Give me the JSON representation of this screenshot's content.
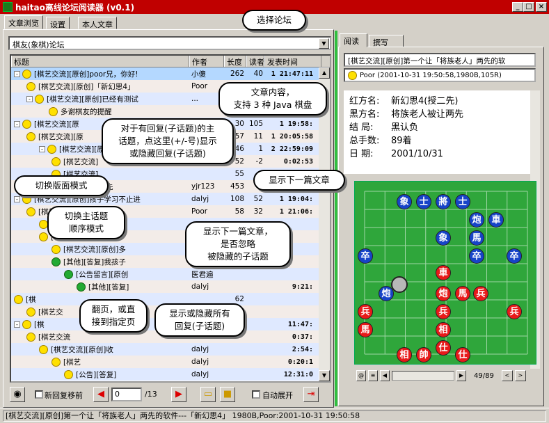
{
  "window": {
    "title": "haitao离线论坛阅读器 (v0.1)",
    "min": "_",
    "max": "□",
    "close": "×"
  },
  "tabs": [
    "文章浏览",
    "设置",
    "本人文章"
  ],
  "forum_select": "棋友(象棋)论坛",
  "columns": {
    "title": "标题",
    "author": "作者",
    "length": "长度",
    "reads": "读者",
    "time": "发表时间"
  },
  "rows": [
    {
      "title": "[棋艺交流][原创]poor兄，你好!",
      "author": "小傻",
      "len": "262",
      "reads": "40",
      "time": "1 21:47:11",
      "pm": "-",
      "sel": true
    },
    {
      "title": "[棋艺交流][原创]「新幻思4」",
      "author": "Poor",
      "len": "",
      "reads": "",
      "time": "",
      "pm": ""
    },
    {
      "title": "[棋艺交流][原创]已经有测试",
      "author": "...",
      "len": "",
      "reads": "",
      "time": "",
      "pm": "-"
    },
    {
      "title": "多谢棋友的提醒",
      "author": "",
      "len": "",
      "reads": "",
      "time": "",
      "pm": ""
    },
    {
      "title": "[棋艺交流][原",
      "author": "",
      "len": "30",
      "reads": "105",
      "time": "1 19:58:",
      "pm": "-"
    },
    {
      "title": "[棋艺交流][原",
      "author": "",
      "len": "57",
      "reads": "11",
      "time": "1 20:05:58",
      "pm": ""
    },
    {
      "title": "[棋艺交流][原",
      "author": "",
      "len": "46",
      "reads": "1",
      "time": "2 22:59:09",
      "pm": "-"
    },
    {
      "title": "[棋艺交流]",
      "author": "",
      "len": "52",
      "reads": "-2",
      "time": "0:02:53",
      "pm": ""
    },
    {
      "title": "[棋艺交流]",
      "author": "",
      "len": "55",
      "reads": "",
      "time": "1 18:00:08",
      "pm": ""
    },
    {
      "title": "[棋艺交流][原创]让X先",
      "author": "yjr123",
      "len": "453",
      "reads": "",
      "time": "",
      "pm": ""
    },
    {
      "title": "[棋艺交流][原创]孩子学习不止进",
      "author": "dalyj",
      "len": "108",
      "reads": "52",
      "time": "1 19:04:",
      "pm": "-"
    },
    {
      "title": "[棋艺交流]大了?是",
      "author": "Poor",
      "len": "58",
      "reads": "32",
      "time": "1 21:06:",
      "pm": ""
    },
    {
      "title": "[棋艺交流]是小学4年",
      "author": "",
      "len": "",
      "reads": "",
      "time": "",
      "pm": ""
    },
    {
      "title": "[棋艺交流][原创]可私",
      "author": "",
      "len": "",
      "reads": "",
      "time": "",
      "pm": ""
    },
    {
      "title": "[棋艺交流][原创]多",
      "author": "",
      "len": "",
      "reads": "",
      "time": "",
      "pm": ""
    },
    {
      "title": "[其他][答复]我孩子",
      "author": "",
      "len": "",
      "reads": "",
      "time": "",
      "pm": ""
    },
    {
      "title": "[公告留言][原创",
      "author": "医君遍",
      "len": "",
      "reads": "",
      "time": "",
      "pm": ""
    },
    {
      "title": "[其他][答复]",
      "author": "dalyj",
      "len": "",
      "reads": "",
      "time": "9:21:",
      "pm": ""
    },
    {
      "title": "[棋",
      "author": "",
      "len": "62",
      "reads": "",
      "time": "",
      "pm": ""
    },
    {
      "title": "[棋艺交",
      "author": "",
      "len": "",
      "reads": "",
      "time": "",
      "pm": ""
    },
    {
      "title": "[棋",
      "author": "",
      "len": "",
      "reads": "",
      "time": "11:47:",
      "pm": "-"
    },
    {
      "title": "[棋艺交流",
      "author": "",
      "len": "",
      "reads": "",
      "time": "0:37:",
      "pm": ""
    },
    {
      "title": "[棋艺交流][原创]收",
      "author": "dalyj",
      "len": "",
      "reads": "",
      "time": "2:54:",
      "pm": ""
    },
    {
      "title": "[棋艺",
      "author": "dalyj",
      "len": "",
      "reads": "",
      "time": "0:20:1",
      "pm": ""
    },
    {
      "title": "[公告][答复]",
      "author": "dalyj",
      "len": "",
      "reads": "",
      "time": "12:31:0",
      "pm": ""
    }
  ],
  "toolbar": {
    "new_reply_label": "新回复移前",
    "page_value": "0",
    "page_total": "/13",
    "auto_expand_label": "自动展开"
  },
  "callouts": {
    "select_forum": "选择论坛",
    "article_content": "文章内容，\n支持 3 种 Java 棋盘",
    "expand_replies": "对于有回复(子话题)的主\n话题，点这里(+/-号)显示\n或隐藏回复(子话题)",
    "toggle_layout": "切换版面模式",
    "next_article": "显示下一篇文章",
    "toggle_order": "切换主话题\n顺序模式",
    "next_skip": "显示下一篇文章，\n是否忽略\n被隐藏的子话题",
    "page_turn": "翻页，或直\n接到指定页",
    "show_hide_all": "显示或隐藏所有\n回复(子话题)"
  },
  "right": {
    "tabs": [
      "阅读",
      "撰写"
    ],
    "article_title": "[棋艺交流][原创]第一个让「将族老人」两先的软",
    "article_meta": "Poor  (2001-10-31 19:50:58,1980B,105R)",
    "fields": [
      {
        "k": "红方名:",
        "v": "新幻思4(授二先)"
      },
      {
        "k": "黑方名:",
        "v": "将族老人被让两先"
      },
      {
        "k": "结  局:",
        "v": "黑认负"
      },
      {
        "k": "总手数:",
        "v": "89着"
      },
      {
        "k": "日  期:",
        "v": "2001/10/31"
      }
    ],
    "board_counter": "49/89"
  },
  "pieces": [
    {
      "t": "象",
      "c": "b"
    },
    {
      "t": "士",
      "c": "b"
    },
    {
      "t": "將",
      "c": "b"
    },
    {
      "t": "士",
      "c": "b"
    },
    {
      "t": "炮",
      "c": "b"
    },
    {
      "t": "車",
      "c": "b"
    },
    {
      "t": "象",
      "c": "b"
    },
    {
      "t": "馬",
      "c": "b"
    },
    {
      "t": "卒",
      "c": "b"
    },
    {
      "t": "卒",
      "c": "b"
    },
    {
      "t": "卒",
      "c": "b"
    },
    {
      "t": "炮",
      "c": "b"
    },
    {
      "t": "車",
      "c": "r"
    },
    {
      "t": "炮",
      "c": "r"
    },
    {
      "t": "馬",
      "c": "r"
    },
    {
      "t": "兵",
      "c": "r"
    },
    {
      "t": "兵",
      "c": "r"
    },
    {
      "t": "兵",
      "c": "r"
    },
    {
      "t": "兵",
      "c": "r"
    },
    {
      "t": "馬",
      "c": "r"
    },
    {
      "t": "相",
      "c": "r"
    },
    {
      "t": "仕",
      "c": "r"
    },
    {
      "t": "相",
      "c": "r"
    },
    {
      "t": "帥",
      "c": "r"
    },
    {
      "t": "仕",
      "c": "r"
    }
  ],
  "status": "[棋艺交流][原创]第一个让「将族老人」两先的软件---「新幻思4」    1980B,Poor:2001-10-31 19:50:58"
}
